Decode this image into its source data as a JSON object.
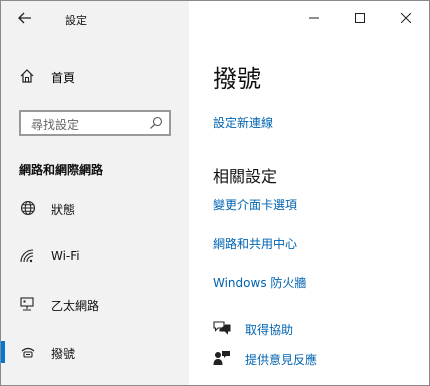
{
  "app": {
    "title": "設定"
  },
  "sidebar": {
    "home_label": "首頁",
    "search": {
      "placeholder": "尋找設定"
    },
    "section_title": "網路和網際網路",
    "items": [
      {
        "label": "狀態",
        "icon": "globe-icon"
      },
      {
        "label": "Wi-Fi",
        "icon": "wifi-icon"
      },
      {
        "label": "乙太網路",
        "icon": "ethernet-icon"
      },
      {
        "label": "撥號",
        "icon": "dialup-icon",
        "selected": true
      }
    ]
  },
  "main": {
    "title": "撥號",
    "setup_link": "設定新連線",
    "related_title": "相關設定",
    "related_links": [
      "變更介面卡選項",
      "網路和共用中心",
      "Windows 防火牆"
    ],
    "help": [
      {
        "label": "取得協助",
        "icon": "chat-help-icon"
      },
      {
        "label": "提供意見反應",
        "icon": "feedback-icon"
      }
    ]
  },
  "colors": {
    "accent": "#0078d7",
    "link": "#0063b1",
    "sidebar_bg": "#f2f2f2"
  }
}
